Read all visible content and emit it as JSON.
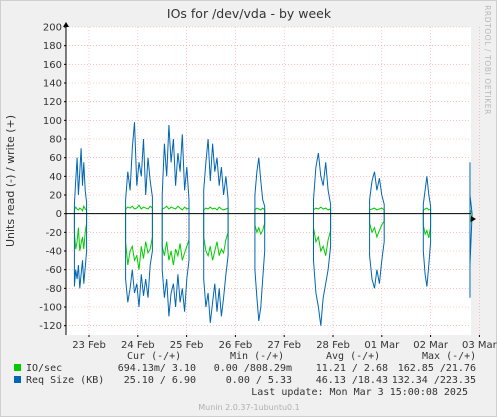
{
  "chart_data": {
    "type": "line",
    "title": "IOs for /dev/vda - by week",
    "ylabel": "Units read (-) / write (+)",
    "side_label": "RRDTOOL / TOBI OETIKER",
    "ylim": [
      -130,
      200
    ],
    "yticks": [
      -120,
      -100,
      -80,
      -60,
      -40,
      -20,
      0,
      20,
      40,
      60,
      80,
      100,
      120,
      140,
      160,
      180,
      200
    ],
    "xlim": [
      0,
      10.6
    ],
    "xticks": [
      {
        "x": 0,
        "label": "23 Feb"
      },
      {
        "x": 1,
        "label": "24 Feb"
      },
      {
        "x": 2,
        "label": "25 Feb"
      },
      {
        "x": 3,
        "label": "26 Feb"
      },
      {
        "x": 4,
        "label": "27 Feb"
      },
      {
        "x": 5,
        "label": "28 Feb"
      },
      {
        "x": 6,
        "label": "01 Mar"
      },
      {
        "x": 7,
        "label": "02 Mar"
      },
      {
        "x": 8,
        "label": "03 Mar"
      }
    ],
    "colors": {
      "io": "#00cc00",
      "req": "#0066b3",
      "grid": "#ff9999",
      "zero": "#000000",
      "plot_bg": "#ffffff",
      "frame_bg": "#f0f0f0"
    },
    "series": [
      {
        "name": "IO/sec",
        "color": "#00cc00",
        "bursts": [
          {
            "x0": -0.3,
            "x1": -0.05,
            "up": [
              4,
              7,
              5,
              4,
              6,
              5,
              3,
              8,
              5,
              4
            ],
            "down": [
              -20,
              -38,
              -30,
              -15,
              -40,
              -32,
              -25,
              -38,
              -20,
              -10
            ]
          },
          {
            "x0": 0.75,
            "x1": 1.3,
            "up": [
              5,
              7,
              6,
              8,
              5,
              6,
              9,
              5,
              7,
              6,
              5,
              8,
              6
            ],
            "down": [
              -30,
              -55,
              -40,
              -35,
              -50,
              -45,
              -60,
              -35,
              -48,
              -30,
              -42,
              -38,
              -25
            ]
          },
          {
            "x0": 1.5,
            "x1": 2.05,
            "up": [
              5,
              6,
              8,
              5,
              7,
              6,
              5,
              8,
              6,
              4,
              7,
              5,
              6
            ],
            "down": [
              -35,
              -45,
              -30,
              -50,
              -40,
              -55,
              -38,
              -45,
              -32,
              -50,
              -42,
              -35,
              -28
            ]
          },
          {
            "x0": 2.35,
            "x1": 2.85,
            "up": [
              4,
              6,
              5,
              7,
              5,
              6,
              4,
              7,
              5,
              4,
              5,
              6
            ],
            "down": [
              -25,
              -40,
              -45,
              -35,
              -50,
              -40,
              -30,
              -45,
              -38,
              -42,
              -28,
              -20
            ]
          },
          {
            "x0": 3.4,
            "x1": 3.6,
            "up": [
              4,
              6,
              5,
              4,
              6,
              4
            ],
            "down": [
              -12,
              -20,
              -15,
              -22,
              -18,
              -10
            ]
          },
          {
            "x0": 4.6,
            "x1": 4.95,
            "up": [
              4,
              6,
              5,
              7,
              5,
              6,
              4,
              5
            ],
            "down": [
              -15,
              -30,
              -25,
              -40,
              -35,
              -45,
              -28,
              -18
            ]
          },
          {
            "x0": 5.75,
            "x1": 6.05,
            "up": [
              4,
              5,
              6,
              4,
              5,
              6,
              4
            ],
            "down": [
              -10,
              -20,
              -15,
              -25,
              -18,
              -12,
              -8
            ]
          },
          {
            "x0": 6.85,
            "x1": 7.0,
            "up": [
              4,
              5,
              6,
              4,
              5
            ],
            "down": [
              -12,
              -22,
              -18,
              -26,
              -14
            ]
          },
          {
            "x0": 7.85,
            "x1": 8.15,
            "up": [
              4,
              6,
              5,
              7,
              5,
              6,
              4
            ],
            "down": [
              -10,
              -22,
              -30,
              -18,
              -25,
              -15,
              -8
            ]
          }
        ]
      },
      {
        "name": "Req Size (KB)",
        "color": "#0066b3",
        "bursts": [
          {
            "x0": -0.3,
            "x1": -0.05,
            "up": [
              10,
              35,
              60,
              20,
              45,
              70,
              30,
              55,
              25,
              12
            ],
            "down": [
              -78,
              -60,
              -70,
              -55,
              -80,
              -65,
              -50,
              -75,
              -58,
              -40
            ]
          },
          {
            "x0": 0.75,
            "x1": 1.3,
            "up": [
              15,
              45,
              25,
              70,
              98,
              30,
              55,
              40,
              80,
              20,
              60,
              35,
              18
            ],
            "down": [
              -70,
              -95,
              -80,
              -60,
              -85,
              -75,
              -100,
              -65,
              -88,
              -70,
              -90,
              -55,
              -40
            ]
          },
          {
            "x0": 1.5,
            "x1": 2.05,
            "up": [
              20,
              75,
              40,
              95,
              55,
              80,
              30,
              65,
              45,
              85,
              25,
              50,
              15
            ],
            "down": [
              -60,
              -90,
              -70,
              -110,
              -85,
              -75,
              -100,
              -65,
              -95,
              -80,
              -105,
              -70,
              -50
            ]
          },
          {
            "x0": 2.35,
            "x1": 2.85,
            "up": [
              25,
              55,
              80,
              35,
              75,
              45,
              60,
              30,
              50,
              20,
              40,
              15
            ],
            "down": [
              -70,
              -100,
              -85,
              -117,
              -95,
              -75,
              -105,
              -80,
              -110,
              -90,
              -65,
              -45
            ]
          },
          {
            "x0": 3.4,
            "x1": 3.6,
            "up": [
              20,
              45,
              60,
              35,
              15,
              8
            ],
            "down": [
              -60,
              -90,
              -115,
              -100,
              -70,
              -40
            ]
          },
          {
            "x0": 4.6,
            "x1": 4.95,
            "up": [
              15,
              50,
              65,
              40,
              30,
              55,
              25,
              10
            ],
            "down": [
              -50,
              -85,
              -100,
              -120,
              -90,
              -75,
              -60,
              -35
            ]
          },
          {
            "x0": 5.75,
            "x1": 6.05,
            "up": [
              15,
              35,
              45,
              25,
              38,
              20,
              10
            ],
            "down": [
              -45,
              -70,
              -80,
              -60,
              -75,
              -50,
              -30
            ]
          },
          {
            "x0": 6.85,
            "x1": 7.0,
            "up": [
              10,
              25,
              40,
              20,
              8
            ],
            "down": [
              -40,
              -65,
              -78,
              -55,
              -30
            ]
          },
          {
            "x0": 7.85,
            "x1": 8.15,
            "up": [
              20,
              45,
              55,
              35,
              50,
              25,
              12
            ],
            "down": [
              -55,
              -75,
              -90,
              -70,
              -85,
              -60,
              -40
            ]
          }
        ]
      }
    ]
  },
  "legend": {
    "headers": {
      "cur": "Cur (-/+)",
      "min": "Min (-/+)",
      "avg": "Avg (-/+)",
      "max": "Max (-/+)"
    },
    "rows": [
      {
        "name": "IO/sec",
        "color": "#00cc00",
        "cur": "694.13m/ 3.10",
        "min": "0.00 /808.29m",
        "avg": "11.21 / 2.68",
        "max": "162.85 /21.76"
      },
      {
        "name": "Req Size (KB)",
        "color": "#0066b3",
        "cur": "25.10 / 6.90",
        "min": "0.00 / 5.33",
        "avg": "46.13 /18.43",
        "max": "132.34 /223.35"
      }
    ]
  },
  "last_update": "Last update: Mon Mar  3 15:00:08 2025",
  "footer": "Munin 2.0.37-1ubuntu0.1"
}
